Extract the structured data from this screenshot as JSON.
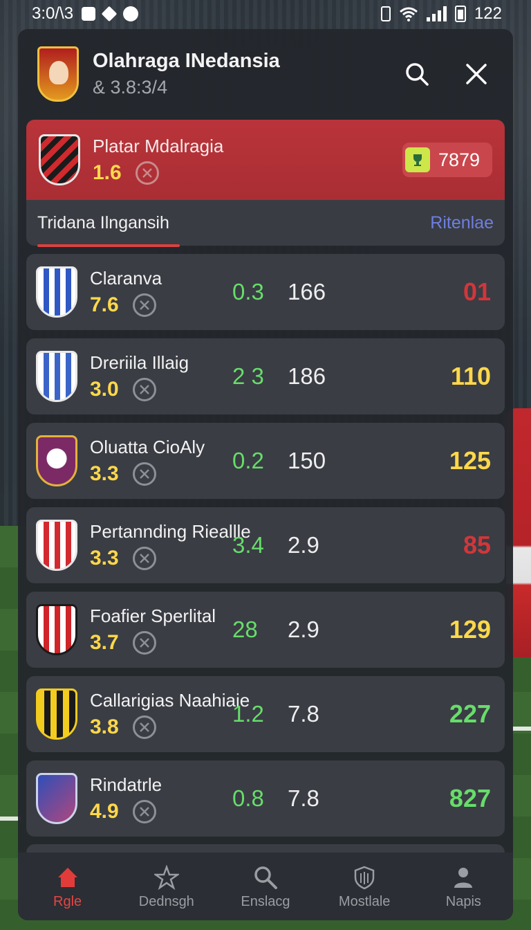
{
  "status_bar": {
    "time": "3:0/\\3",
    "battery": "122"
  },
  "header": {
    "title": "Olahraga INedansia",
    "subtitle": "& 3.8:3/4",
    "search_icon": "search-icon",
    "close_icon": "close-icon"
  },
  "featured": {
    "name": "Platar Mdalragia",
    "rating": "1.6",
    "score": "7879"
  },
  "tabs": {
    "active": "Tridana Ilngansih",
    "link": "Ritenlae"
  },
  "colors": {
    "red": "#d2363a",
    "yellow": "#ffd84a",
    "green": "#67dd6a",
    "accent_blue": "#6f7fe0"
  },
  "rows": [
    {
      "name": "Claranva",
      "rating": "7.6",
      "stat_a": "0.3",
      "stat_b": "166",
      "stat_c": "01",
      "stat_c_color": "#d2363a"
    },
    {
      "name": "Dreriila Illaig",
      "rating": "3.0",
      "stat_a": "2 3",
      "stat_b": "186",
      "stat_c": "110",
      "stat_c_color": "#ffd84a"
    },
    {
      "name": "Oluatta CioAly",
      "rating": "3.3",
      "stat_a": "0.2",
      "stat_b": "150",
      "stat_c": "125",
      "stat_c_color": "#ffd84a"
    },
    {
      "name": "Pertannding Rieallle",
      "rating": "3.3",
      "stat_a": "3.4",
      "stat_b": "2.9",
      "stat_c": "85",
      "stat_c_color": "#d2363a"
    },
    {
      "name": "Foafier Sperlital",
      "rating": "3.7",
      "stat_a": "28",
      "stat_b": "2.9",
      "stat_c": "129",
      "stat_c_color": "#ffd84a"
    },
    {
      "name": "Callarigias Naahiaie",
      "rating": "3.8",
      "stat_a": "1.2",
      "stat_b": "7.8",
      "stat_c": "227",
      "stat_c_color": "#67dd6a"
    },
    {
      "name": "Rindatrle",
      "rating": "4.9",
      "stat_a": "0.8",
      "stat_b": "7.8",
      "stat_c": "827",
      "stat_c_color": "#67dd6a"
    }
  ],
  "nav": [
    {
      "label": "Rgle",
      "icon": "home-icon",
      "active": true
    },
    {
      "label": "Dednsgh",
      "icon": "star-icon",
      "active": false
    },
    {
      "label": "Enslacg",
      "icon": "search-icon",
      "active": false
    },
    {
      "label": "Mostlale",
      "icon": "shield-icon",
      "active": false
    },
    {
      "label": "Napis",
      "icon": "profile-icon",
      "active": false
    }
  ]
}
